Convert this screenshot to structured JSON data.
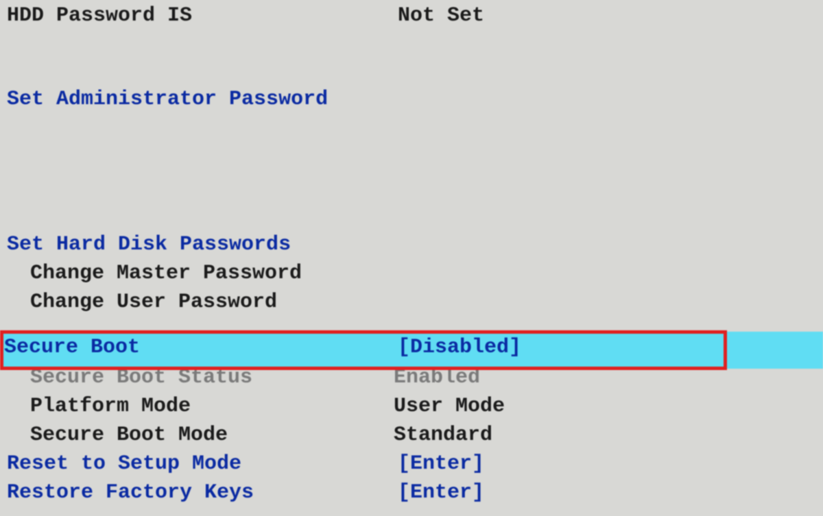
{
  "hdd_password": {
    "label": "HDD Password IS",
    "value": "Not Set"
  },
  "set_admin_password": "Set Administrator Password",
  "set_hdd_passwords": "Set Hard Disk Passwords",
  "change_master": "Change Master Password",
  "change_user": "Change User Password",
  "secure_boot": {
    "label": "Secure Boot",
    "value": "[Disabled]"
  },
  "secure_boot_status": {
    "label": "Secure Boot Status",
    "value": "Enabled"
  },
  "platform_mode": {
    "label": "Platform Mode",
    "value": "User Mode"
  },
  "secure_boot_mode": {
    "label": "Secure Boot Mode",
    "value": "Standard"
  },
  "reset_to_setup_mode": {
    "label": "Reset to Setup Mode",
    "value": "[Enter]"
  },
  "restore_factory_keys": {
    "label": "Restore Factory Keys",
    "value": "[Enter]"
  }
}
